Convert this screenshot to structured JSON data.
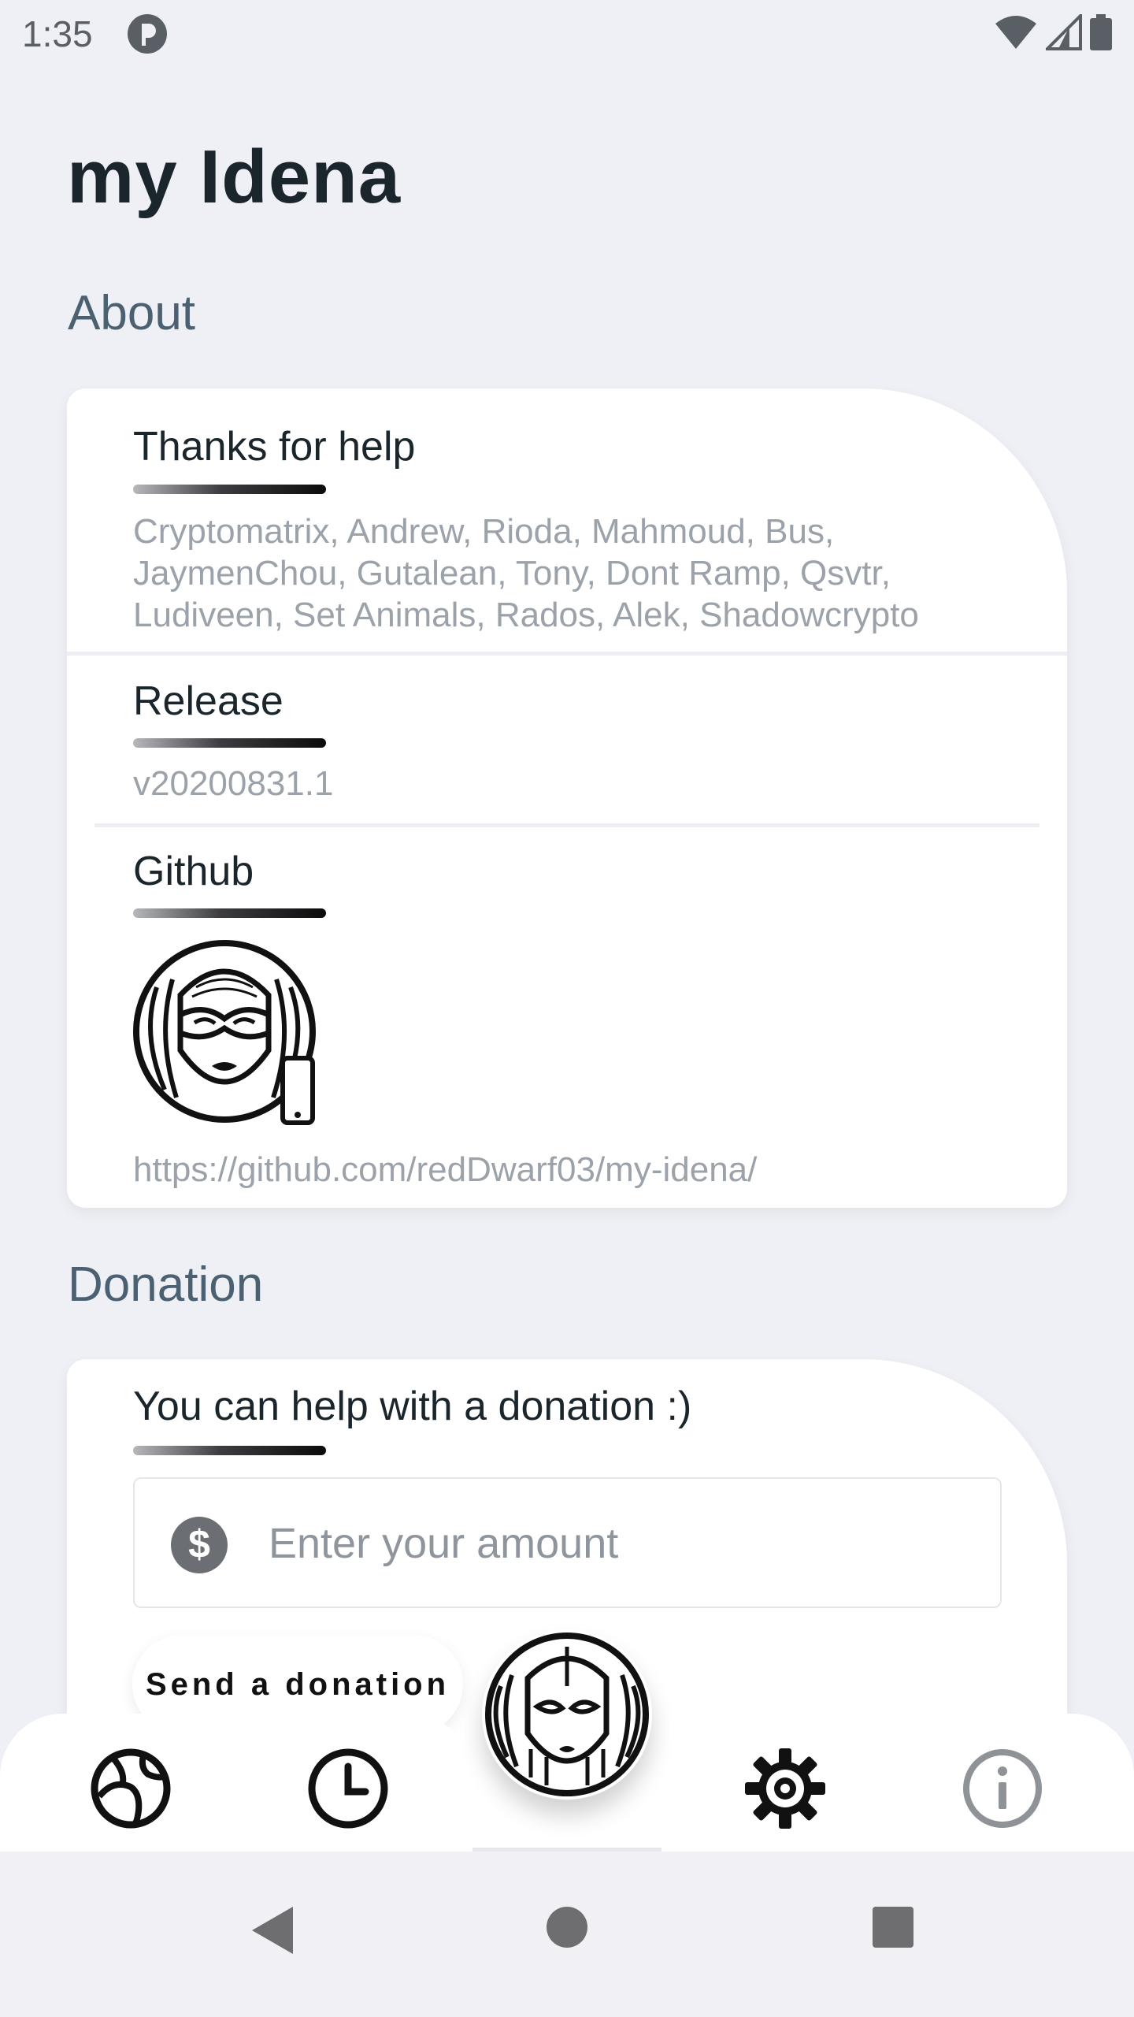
{
  "status": {
    "time": "1:35"
  },
  "app": {
    "title": "my Idena"
  },
  "about": {
    "section_title": "About",
    "thanks": {
      "title": "Thanks for help",
      "lines": [
        "Cryptomatrix, Andrew, Rioda, Mahmoud, Bus,",
        "JaymenChou, Gutalean, Tony, Dont Ramp, Qsvtr,",
        "Ludiveen, Set Animals, Rados, Alek, Shadowcrypto"
      ]
    },
    "release": {
      "title": "Release",
      "version": "v20200831.1"
    },
    "github": {
      "title": "Github",
      "url": "https://github.com/redDwarf03/my-idena/"
    }
  },
  "donation": {
    "section_title": "Donation",
    "title": "You can help with a donation :)",
    "amount_placeholder": "Enter your amount",
    "send_label": "Send a donation"
  },
  "nav": {
    "items": [
      "globe-icon",
      "clock-icon",
      "idena-logo",
      "gear-icon",
      "info-icon"
    ]
  }
}
